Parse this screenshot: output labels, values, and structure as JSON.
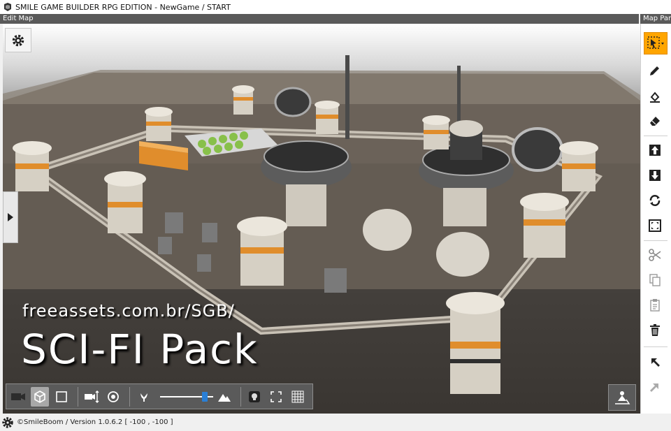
{
  "window": {
    "title": "SMILE GAME BUILDER RPG EDITION - NewGame / START"
  },
  "edit_map": {
    "header": "Edit Map"
  },
  "map_parts": {
    "header": "Map Par"
  },
  "overlay": {
    "url": "freeassets.com.br/SGB/",
    "title": "SCI-FI Pack"
  },
  "bottom_toolbar": {
    "items": [
      "camera-icon",
      "cube-view-icon",
      "square-view-icon",
      "camera-move-icon",
      "rotate-camera-icon",
      "flower-icon",
      "zoom-slider",
      "mountain-icon",
      "light-bulb-icon",
      "fullscreen-icon",
      "grid-icon"
    ],
    "zoom_level": 0.88
  },
  "right_tools": [
    "select-tool-icon",
    "pencil-icon",
    "fill-icon",
    "eraser-icon",
    "raise-icon",
    "lower-icon",
    "rotate-icon",
    "expand-icon",
    "cut-icon",
    "copy-icon",
    "paste-icon",
    "delete-icon",
    "undo-icon",
    "redo-icon"
  ],
  "status": {
    "text": "©SmileBoom / Version 1.0.6.2  [ -100 , -100 ]"
  },
  "colors": {
    "accent": "#ffa500",
    "slider": "#2a7fd6",
    "toolbar_bg": "#5a5a5a",
    "ground": "#6a6157"
  }
}
